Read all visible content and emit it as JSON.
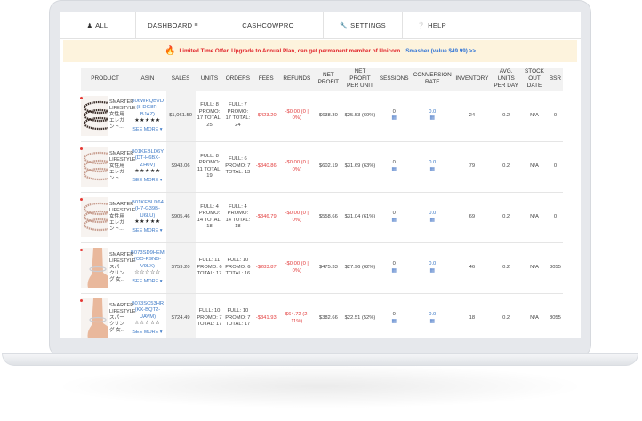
{
  "nav": {
    "items": [
      {
        "label": "ALL",
        "icon": "user-icon"
      },
      {
        "label": "DASHBOARD",
        "icon": "menu-icon"
      },
      {
        "label": "CASHCOWPRO",
        "icon": ""
      },
      {
        "label": "SETTINGS",
        "icon": "wrench-icon"
      },
      {
        "label": "HELP",
        "icon": "question-icon"
      }
    ]
  },
  "banner": {
    "text1": "Limited Time Offer, Upgrade to Annual Plan, can get permanent member of Unicorn",
    "text2": "Smasher (value $49.99) >>"
  },
  "table": {
    "headers": [
      "PRODUCT",
      "ASIN",
      "SALES",
      "UNITS",
      "ORDERS",
      "FEES",
      "REFUNDS",
      "NET PROFIT",
      "NET PROFIT PER UNIT",
      "SESSIONS",
      "CONVERSION RATE",
      "INVENTORY",
      "AVG. UNITS PER DAY",
      "STOCK OUT DATE",
      "BSR"
    ],
    "rows": [
      {
        "product": "SMARTER LIFESTYLE 女性用 エレガント...",
        "asin": "B06WRQBVD (8-DG8R-BJAZ)",
        "rating": "★★★★★",
        "see_more": "SEE MORE",
        "sales": "$1,061.50",
        "units": "FULL: 8 PROMO: 17 TOTAL: 25",
        "orders": "FULL: 7 PROMO: 17 TOTAL: 24",
        "fees": "-$423.20",
        "refunds": "-$0.00 (0 | 0%)",
        "net_profit": "$638.30",
        "npu": "$25.53 (60%)",
        "sessions": "0",
        "conversion": "0.0",
        "inventory": "24",
        "avg": "0.2",
        "stockout": "N/A",
        "bsr": "0"
      },
      {
        "product": "SMARTER LIFESTYLE 女性用 エレガント...",
        "asin": "B01KEBLD6Y (DT-H6BX-ZH0V)",
        "rating": "★★★★★",
        "see_more": "SEE MORE",
        "sales": "$943.06",
        "units": "FULL: 8 PROMO: 11 TOTAL: 19",
        "orders": "FULL: 6 PROMO: 7 TOTAL: 13",
        "fees": "-$340.86",
        "refunds": "-$0.00 (0 | 0%)",
        "net_profit": "$602.19",
        "npu": "$31.69 (63%)",
        "sessions": "0",
        "conversion": "0.0",
        "inventory": "79",
        "avg": "0.2",
        "stockout": "N/A",
        "bsr": "0"
      },
      {
        "product": "SMARTER LIFESTYLE 女性用 エレガント...",
        "asin": "B01KEBLD64 (H7-G39B-U6LU)",
        "rating": "★★★★★",
        "see_more": "SEE MORE",
        "sales": "$905.46",
        "units": "FULL: 4 PROMO: 14 TOTAL: 18",
        "orders": "FULL: 4 PROMO: 14 TOTAL: 18",
        "fees": "-$346.79",
        "refunds": "-$0.00 (0 | 0%)",
        "net_profit": "$558.66",
        "npu": "$31.04 (61%)",
        "sessions": "0",
        "conversion": "0.0",
        "inventory": "69",
        "avg": "0.2",
        "stockout": "N/A",
        "bsr": "0"
      },
      {
        "product": "SMARTER LIFESTYLE スパークリング 女...",
        "asin": "B073SD9HEM (OO-R9NB-V9LX)",
        "rating": "☆☆☆☆☆",
        "see_more": "SEE MORE",
        "sales": "$759.20",
        "units": "FULL: 11 PROMO: 6 TOTAL: 17",
        "orders": "FULL: 10 PROMO: 6 TOTAL: 16",
        "fees": "-$283.87",
        "refunds": "-$0.00 (0 | 0%)",
        "net_profit": "$475.33",
        "npu": "$27.96 (62%)",
        "sessions": "0",
        "conversion": "0.0",
        "inventory": "46",
        "avg": "0.2",
        "stockout": "N/A",
        "bsr": "8055"
      },
      {
        "product": "SMARTER LIFESTYLE スパークリング 女...",
        "asin": "B073SC53HR (KX-BQT2-UAVM)",
        "rating": "☆☆☆☆☆",
        "see_more": "SEE MORE",
        "sales": "$724.49",
        "units": "FULL: 10 PROMO: 7 TOTAL: 17",
        "orders": "FULL: 10 PROMO: 7 TOTAL: 17",
        "fees": "-$341.93",
        "refunds": "-$64.72 (2 | 11%)",
        "net_profit": "$382.66",
        "npu": "$22.51 (52%)",
        "sessions": "0",
        "conversion": "0.0",
        "inventory": "18",
        "avg": "0.2",
        "stockout": "N/A",
        "bsr": "8055"
      }
    ]
  },
  "colors": {
    "accent": "#3b78c6",
    "negative": "#e23b3b",
    "banner_bg": "#fdf3dd"
  }
}
